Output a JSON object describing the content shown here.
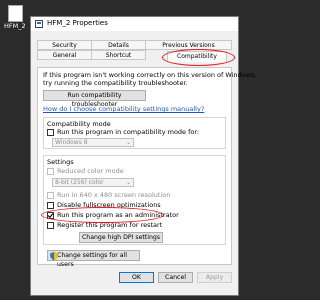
{
  "desktop": {
    "icon_label": "HFM_2"
  },
  "window": {
    "title": "HFM_2 Properties",
    "tabs_row1": [
      "Security",
      "Details",
      "Previous Versions"
    ],
    "tabs_row2": [
      "General",
      "Shortcut",
      "Compatibility"
    ],
    "active_tab": "Compatibility"
  },
  "compat": {
    "intro": "If this program isn't working correctly on this version of Windows, try running the compatibility troubleshooter.",
    "intro_line1": "If this program isn't working correctly on this version of Windows,",
    "intro_line2": "try running the compatibility troubleshooter.",
    "troubleshooter_button": "Run compatibility troubleshooter",
    "manual_link": "How do I choose compatibility settings manually?",
    "mode_group": {
      "title": "Compatibility mode",
      "checkbox_label": "Run this program in compatibility mode for:",
      "select_value": "Windows 8"
    },
    "settings_group": {
      "title": "Settings",
      "reduced_color": "Reduced color mode",
      "color_select_value": "8-bit (256) color",
      "run_640": "Run in 640 x 480 screen resolution",
      "disable_fullscreen": "Disable fullscreen optimizations",
      "run_admin": "Run this program as an administrator",
      "register_restart": "Register this program for restart",
      "dpi_button": "Change high DPI settings"
    },
    "all_users_button": "Change settings for all users"
  },
  "footer": {
    "ok": "OK",
    "cancel": "Cancel",
    "apply": "Apply"
  },
  "colors": {
    "annotation": "#e41b1b",
    "link": "#1e55c5"
  },
  "icons": [
    "document-icon",
    "shield-icon",
    "chevron-down-icon"
  ]
}
